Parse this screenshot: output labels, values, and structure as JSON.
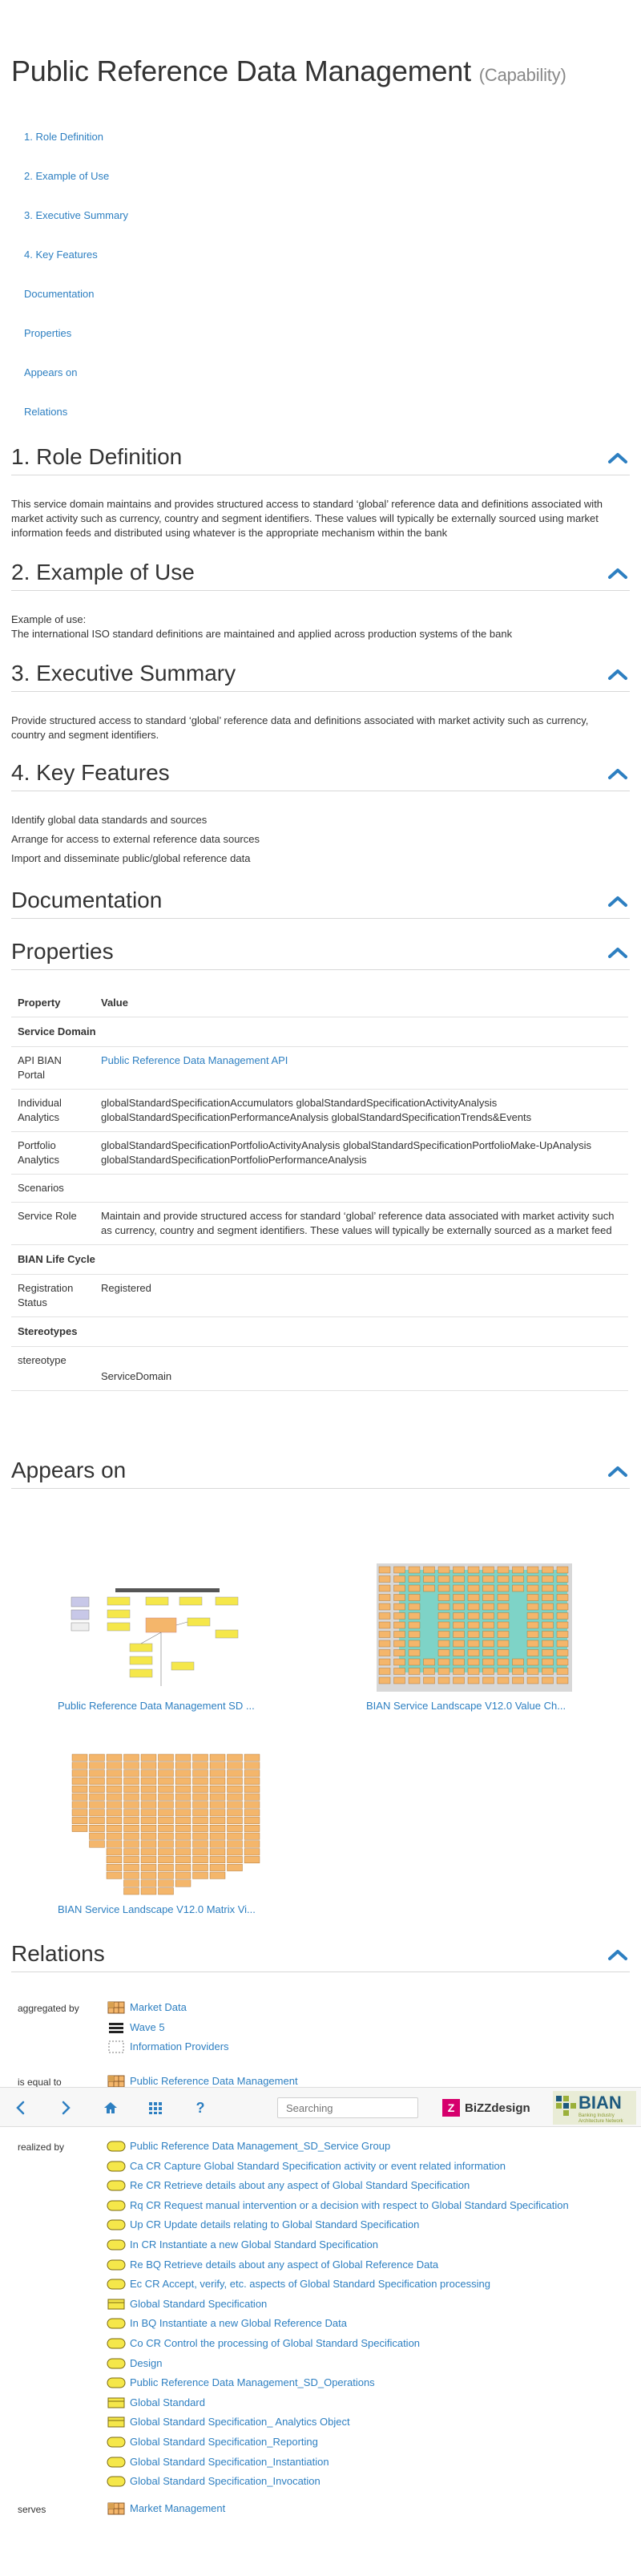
{
  "page": {
    "title": "Public Reference Data Management",
    "capability_label": "(Capability)"
  },
  "toc": [
    "1. Role Definition",
    "2. Example of Use",
    "3. Executive Summary",
    "4. Key Features",
    "Documentation",
    "Properties",
    "Appears on",
    "Relations"
  ],
  "sections": {
    "role_definition": {
      "heading": "1. Role Definition",
      "text": "This service domain maintains and provides structured access to standard ‘global’ reference data and definitions associated with market activity such as currency, country and segment identifiers. These values will typically be externally sourced using market information feeds and distributed using whatever is the appropriate mechanism within the bank"
    },
    "example_of_use": {
      "heading": "2. Example of Use",
      "line1": "Example of use:",
      "line2": "The international ISO standard definitions are maintained and applied across production systems of the bank"
    },
    "executive_summary": {
      "heading": "3. Executive Summary",
      "text": "Provide structured access to standard ‘global’ reference data and definitions associated with market activity such as currency, country and segment identifiers."
    },
    "key_features": {
      "heading": "4. Key Features",
      "items": [
        "Identify global data standards and sources",
        "Arrange for access to external reference data sources",
        "Import and disseminate public/global reference data"
      ]
    },
    "documentation": {
      "heading": "Documentation"
    },
    "properties": {
      "heading": "Properties"
    },
    "appears_on": {
      "heading": "Appears on"
    },
    "relations": {
      "heading": "Relations"
    }
  },
  "properties": {
    "col_property": "Property",
    "col_value": "Value",
    "group_service_domain": "Service Domain",
    "api_portal_label": "API BIAN Portal",
    "api_portal_value": "Public Reference Data Management API",
    "individual_analytics_label": "Individual Analytics",
    "individual_analytics_value": "globalStandardSpecificationAccumulators globalStandardSpecificationActivityAnalysis globalStandardSpecificationPerformanceAnalysis globalStandardSpecificationTrends&Events",
    "portfolio_analytics_label": "Portfolio Analytics",
    "portfolio_analytics_value": "globalStandardSpecificationPortfolioActivityAnalysis globalStandardSpecificationPortfolioMake-UpAnalysis globalStandardSpecificationPortfolioPerformanceAnalysis",
    "scenarios_label": "Scenarios",
    "service_role_label": "Service Role",
    "service_role_value": "Maintain and provide structured access for standard ‘global’ reference data associated with market activity such as currency, country and segment identifiers. These values will typically be externally sourced as a market feed",
    "group_lifecycle": "BIAN Life Cycle",
    "registration_label": "Registration Status",
    "registration_value": "Registered",
    "group_stereotypes": "Stereotypes",
    "stereotype_label": "stereotype",
    "stereotype_value": "ServiceDomain"
  },
  "appears_on": [
    "Public Reference Data Management SD ...",
    "BIAN Service Landscape V12.0 Value Ch...",
    "BIAN Service Landscape V12.0 Matrix Vi..."
  ],
  "relations": {
    "aggregated_by_label": "aggregated by",
    "aggregated_by": [
      {
        "label": "Market Data",
        "icon": "grid-icon"
      },
      {
        "label": "Wave 5",
        "icon": "stack-icon"
      },
      {
        "label": "Information Providers",
        "icon": "dotted-box-icon"
      }
    ],
    "is_equal_to_label": "is equal to",
    "is_equal_to": [
      {
        "label": "Public Reference Data Management",
        "icon": "grid-icon"
      }
    ],
    "realized_by_label": "realized by",
    "realized_by": [
      {
        "label": "Public Reference Data Management_SD_Service Group",
        "icon": "service-icon"
      },
      {
        "label": "Ca CR Capture Global Standard Specification activity or event related information",
        "icon": "service-icon"
      },
      {
        "label": "Re CR Retrieve details about any aspect of Global Standard Specification",
        "icon": "service-icon"
      },
      {
        "label": "Rq CR Request manual intervention or a decision with respect to Global Standard Specification",
        "icon": "service-icon"
      },
      {
        "label": "Up CR Update details relating to Global Standard Specification",
        "icon": "service-icon"
      },
      {
        "label": "In CR Instantiate a new Global Standard Specification",
        "icon": "service-icon"
      },
      {
        "label": "Re BQ Retrieve details about any aspect of Global Reference Data",
        "icon": "service-icon"
      },
      {
        "label": "Ec CR Accept, verify, etc. aspects of Global Standard Specification processing",
        "icon": "service-icon"
      },
      {
        "label": "Global Standard Specification",
        "icon": "object-icon"
      },
      {
        "label": "In BQ Instantiate a new Global Reference Data",
        "icon": "service-icon"
      },
      {
        "label": "Co CR Control the processing of Global Standard Specification",
        "icon": "service-icon"
      },
      {
        "label": "Design",
        "icon": "service-icon"
      },
      {
        "label": "Public Reference Data Management_SD_Operations",
        "icon": "service-icon"
      },
      {
        "label": "Global Standard",
        "icon": "object-icon"
      },
      {
        "label": "Global Standard Specification_ Analytics Object",
        "icon": "object-icon"
      },
      {
        "label": "Global Standard Specification_Reporting",
        "icon": "service-icon"
      },
      {
        "label": "Global Standard Specification_Instantiation",
        "icon": "service-icon"
      },
      {
        "label": "Global Standard Specification_Invocation",
        "icon": "service-icon"
      }
    ],
    "serves_label": "serves",
    "serves": [
      {
        "label": "Market Management",
        "icon": "grid-icon"
      }
    ]
  },
  "bottom_bar": {
    "search_placeholder": "Searching",
    "bizzdesign_label": "BiZZdesign",
    "bian_label": "BIAN",
    "bian_tagline": "Banking Industry Architecture Network",
    "help_label": "?"
  },
  "colors": {
    "link": "#2d7fc1",
    "accent_orange": "#f4b66b",
    "accent_teal": "#7ed3c7",
    "accent_yellow": "#f5e74a"
  }
}
